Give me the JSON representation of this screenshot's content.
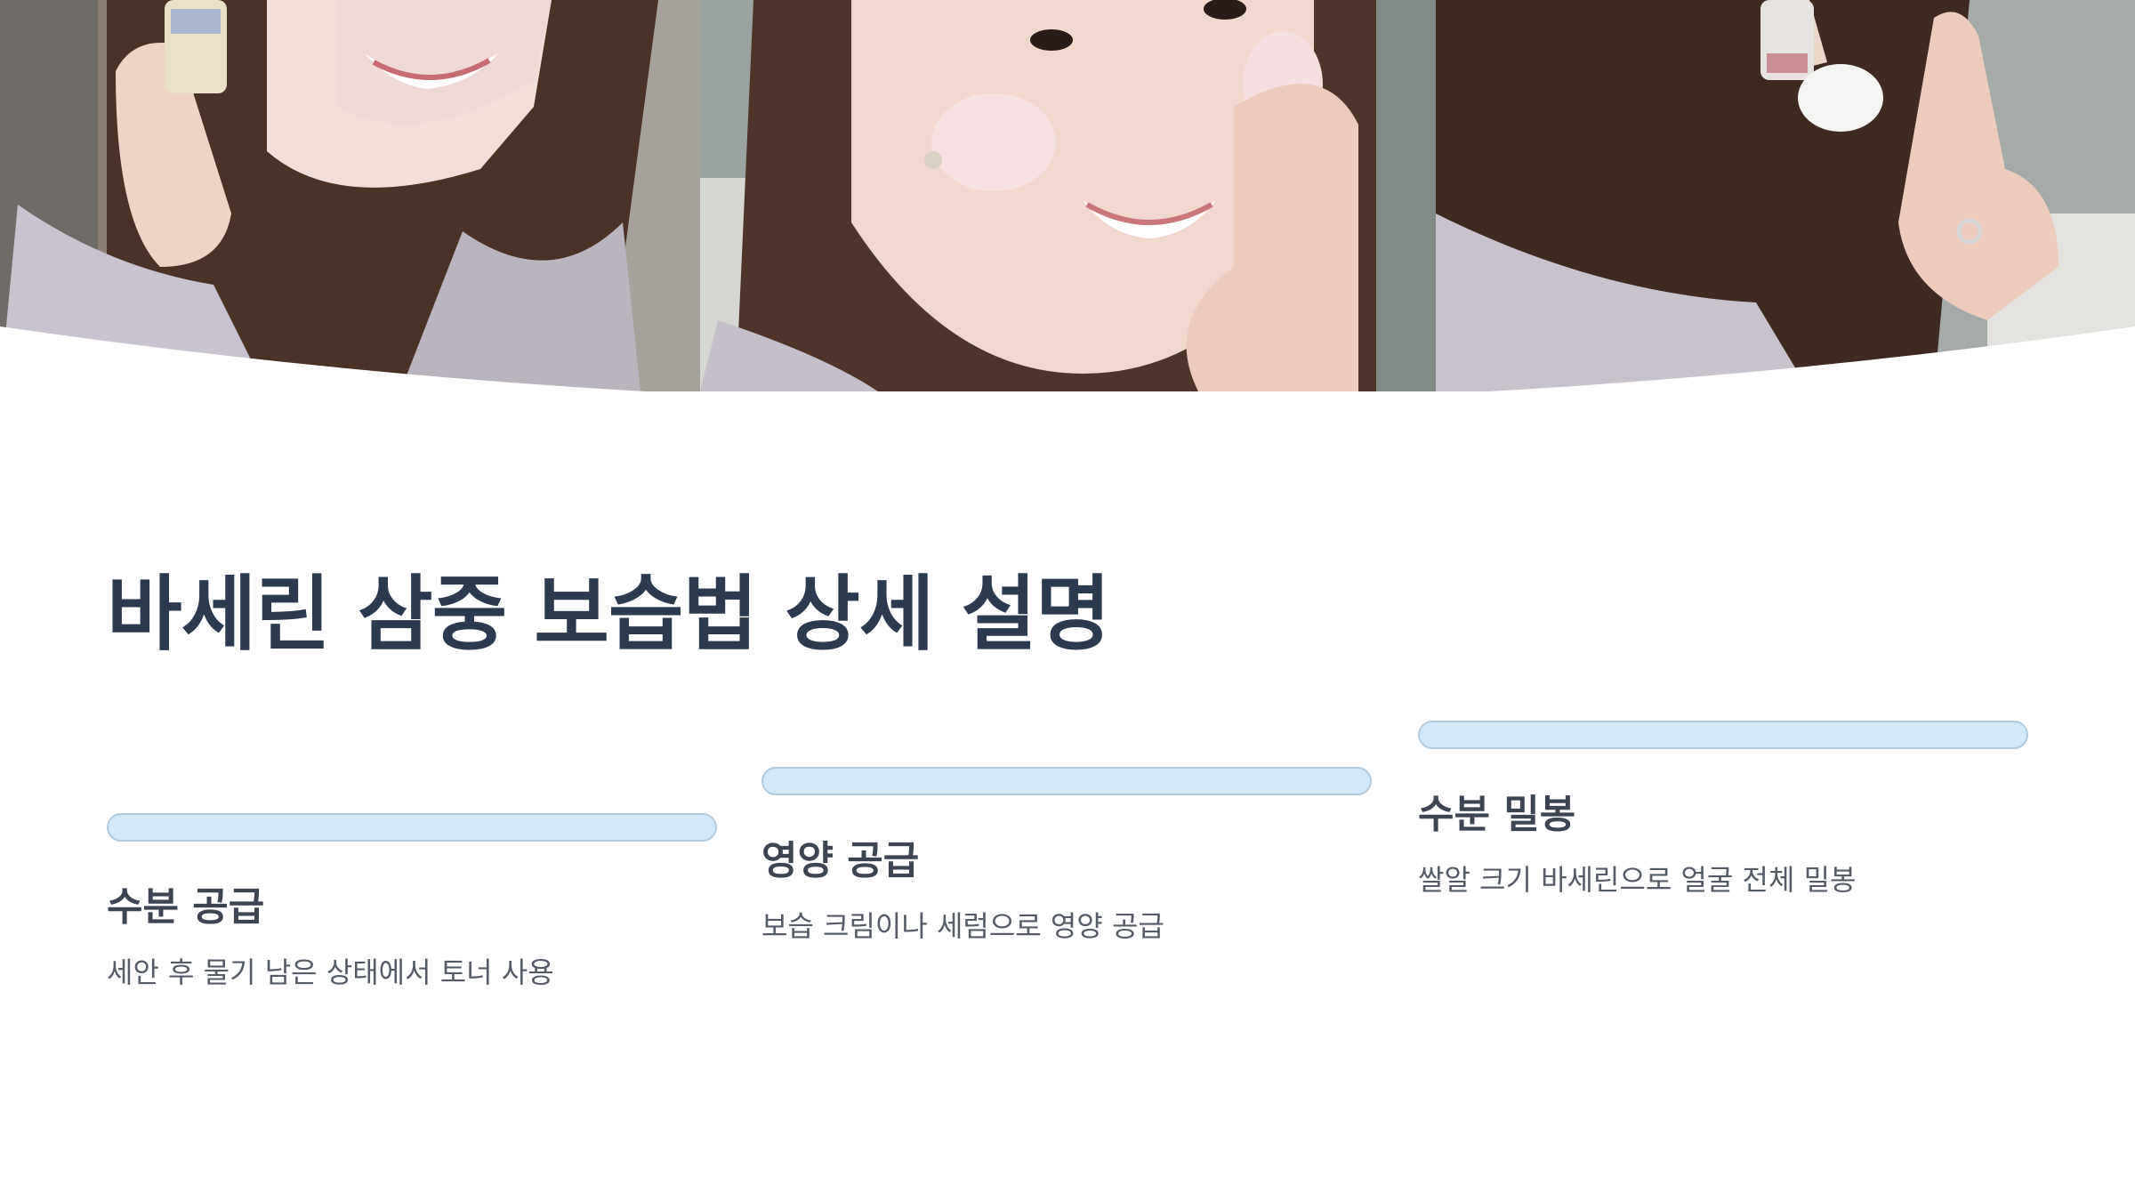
{
  "title": "바세린 삼중 보습법 상세 설명",
  "hero": {
    "photos": [
      {
        "icon": "photo-woman-holding-jar-icon"
      },
      {
        "icon": "photo-woman-cream-on-cheeks-icon"
      },
      {
        "icon": "photo-woman-cotton-pad-icon"
      }
    ]
  },
  "steps": [
    {
      "title": "수분 공급",
      "description": "세안 후 물기 남은 상태에서 토너 사용"
    },
    {
      "title": "영양 공급",
      "description": "보습 크림이나 세럼으로 영양 공급"
    },
    {
      "title": "수분 밀봉",
      "description": "쌀알 크기 바세린으로 얼굴 전체 밀봉"
    }
  ],
  "colors": {
    "title": "#2c3a4f",
    "bar_fill": "#d3e8f8",
    "bar_border": "#b2cbdc",
    "step_title": "#3d4552",
    "step_text": "#555c68"
  }
}
